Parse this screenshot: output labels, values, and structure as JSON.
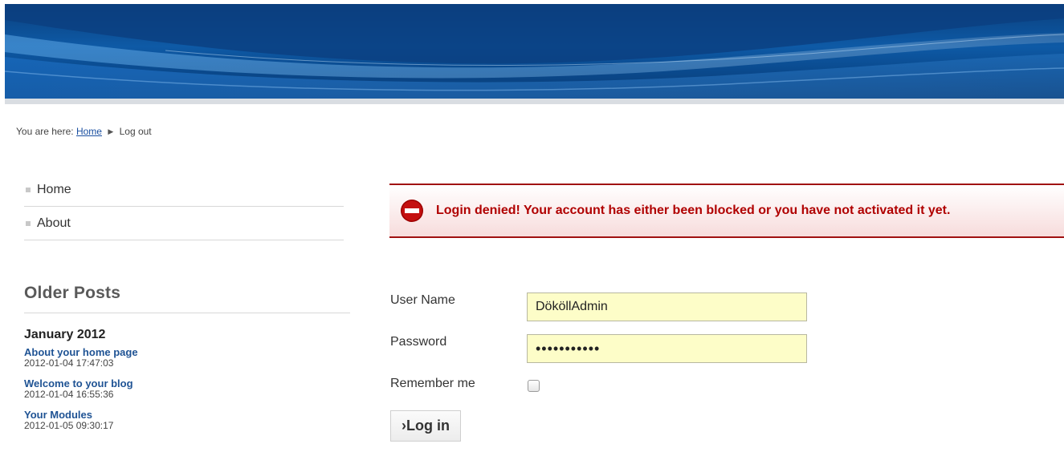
{
  "breadcrumb": {
    "prefix": "You are here:",
    "home": "Home",
    "separator": "▶",
    "current": "Log out"
  },
  "menu": {
    "items": [
      {
        "label": "Home"
      },
      {
        "label": "About"
      }
    ]
  },
  "older_posts": {
    "title": "Older Posts",
    "month": "January 2012",
    "posts": [
      {
        "title": "About your home page",
        "date": "2012-01-04 17:47:03"
      },
      {
        "title": "Welcome to your blog",
        "date": "2012-01-04 16:55:36"
      },
      {
        "title": "Your Modules",
        "date": "2012-01-05 09:30:17"
      }
    ]
  },
  "alert": {
    "message": "Login denied! Your account has either been blocked or you have not activated it yet.",
    "icon": "stop-icon",
    "color": "#b00000"
  },
  "login_form": {
    "username_label": "User Name",
    "username_value": "DököllAdmin",
    "password_label": "Password",
    "password_value": "•••••••••••",
    "remember_label": "Remember me",
    "remember_checked": false,
    "submit_label": "›Log in"
  },
  "colors": {
    "banner": "#0e5aa6",
    "link": "#1f5394",
    "input_bg": "#fdfdc8"
  }
}
